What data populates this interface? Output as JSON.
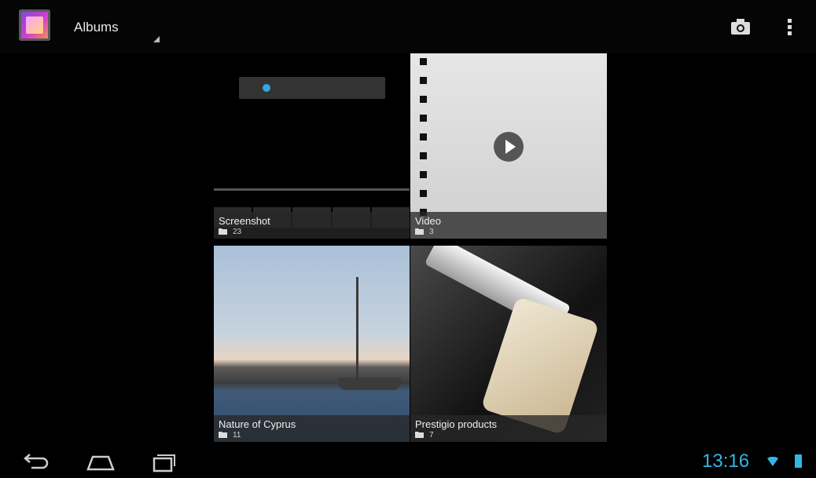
{
  "actionbar": {
    "title": "Albums",
    "icons": [
      "gallery-app-icon",
      "camera-icon",
      "overflow-menu-icon"
    ]
  },
  "albums": [
    {
      "name": "Screenshot",
      "count": "23"
    },
    {
      "name": "Video",
      "count": "3"
    },
    {
      "name": "Nature of Cyprus",
      "count": "11"
    },
    {
      "name": "Prestigio products",
      "count": "7"
    }
  ],
  "navbar": {
    "icons": [
      "back-icon",
      "home-icon",
      "recent-apps-icon"
    ]
  },
  "status": {
    "time": "13:16",
    "icons": [
      "wifi-icon",
      "battery-icon"
    ],
    "accent_color": "#33b5e5"
  }
}
